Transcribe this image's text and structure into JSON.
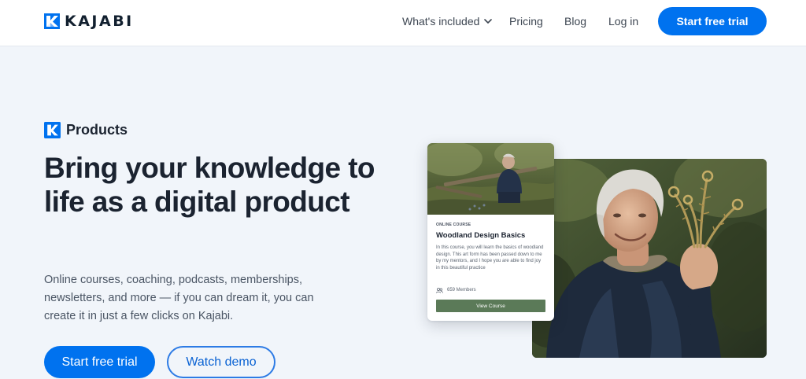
{
  "header": {
    "logo_text": "KAJABI",
    "nav": {
      "whats_included": "What's included",
      "pricing": "Pricing",
      "blog": "Blog",
      "login": "Log in"
    },
    "cta": "Start free trial"
  },
  "hero": {
    "eyebrow": "Products",
    "headline": "Bring your knowledge to life as a digital product",
    "subcopy": "Online courses, coaching, podcasts, memberships, newsletters, and more — if you can dream it, you can create it in just a few clicks on Kajabi.",
    "primary_button": "Start free trial",
    "secondary_button": "Watch demo"
  },
  "course_card": {
    "kicker": "ONLINE COURSE",
    "title": "Woodland Design Basics",
    "description": "In this course, you will learn the basics of woodland design. This art form has been passed down to me by my mentors, and I hope you are able to find joy in this beautiful practice",
    "members": "659 Members",
    "button": "View Course"
  },
  "colors": {
    "brand_blue": "#0072ef",
    "page_bg": "#f1f5fa",
    "card_button_green": "#5b7a58"
  },
  "icons": {
    "logo": "kajabi-k-logo-icon",
    "nav_dropdown": "chevron-down-icon",
    "members": "users-icon"
  }
}
